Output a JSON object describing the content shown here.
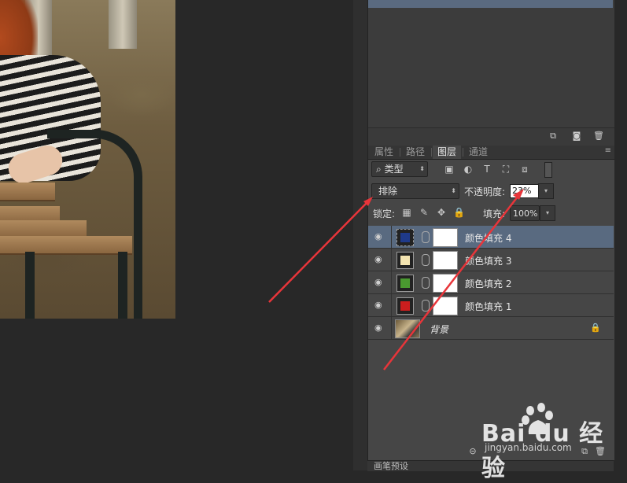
{
  "history": {
    "item_label": ""
  },
  "tabs": [
    "属性",
    "路径",
    "图层",
    "通道"
  ],
  "active_tab": "图层",
  "filter": {
    "label": "类型"
  },
  "blend_mode": "排除",
  "opacity": {
    "label": "不透明度:",
    "value": "23%"
  },
  "lock": {
    "label": "锁定:"
  },
  "fill": {
    "label": "填充:",
    "value": "100%"
  },
  "layers": [
    {
      "name": "颜色填充 4",
      "color": "#1f3a8a",
      "selected": true
    },
    {
      "name": "颜色填充 3",
      "color": "#f3e4b0",
      "selected": false
    },
    {
      "name": "颜色填充 2",
      "color": "#4a9a30",
      "selected": false
    },
    {
      "name": "颜色填充 1",
      "color": "#cc1e1e",
      "selected": false
    },
    {
      "name": "背景",
      "color": "",
      "selected": false
    }
  ],
  "bottom_panel": {
    "label": "画笔预设"
  },
  "watermark": {
    "brand": "Bai du 经验",
    "url": "jingyan.baidu.com"
  },
  "annotation_color": "#e8353a"
}
